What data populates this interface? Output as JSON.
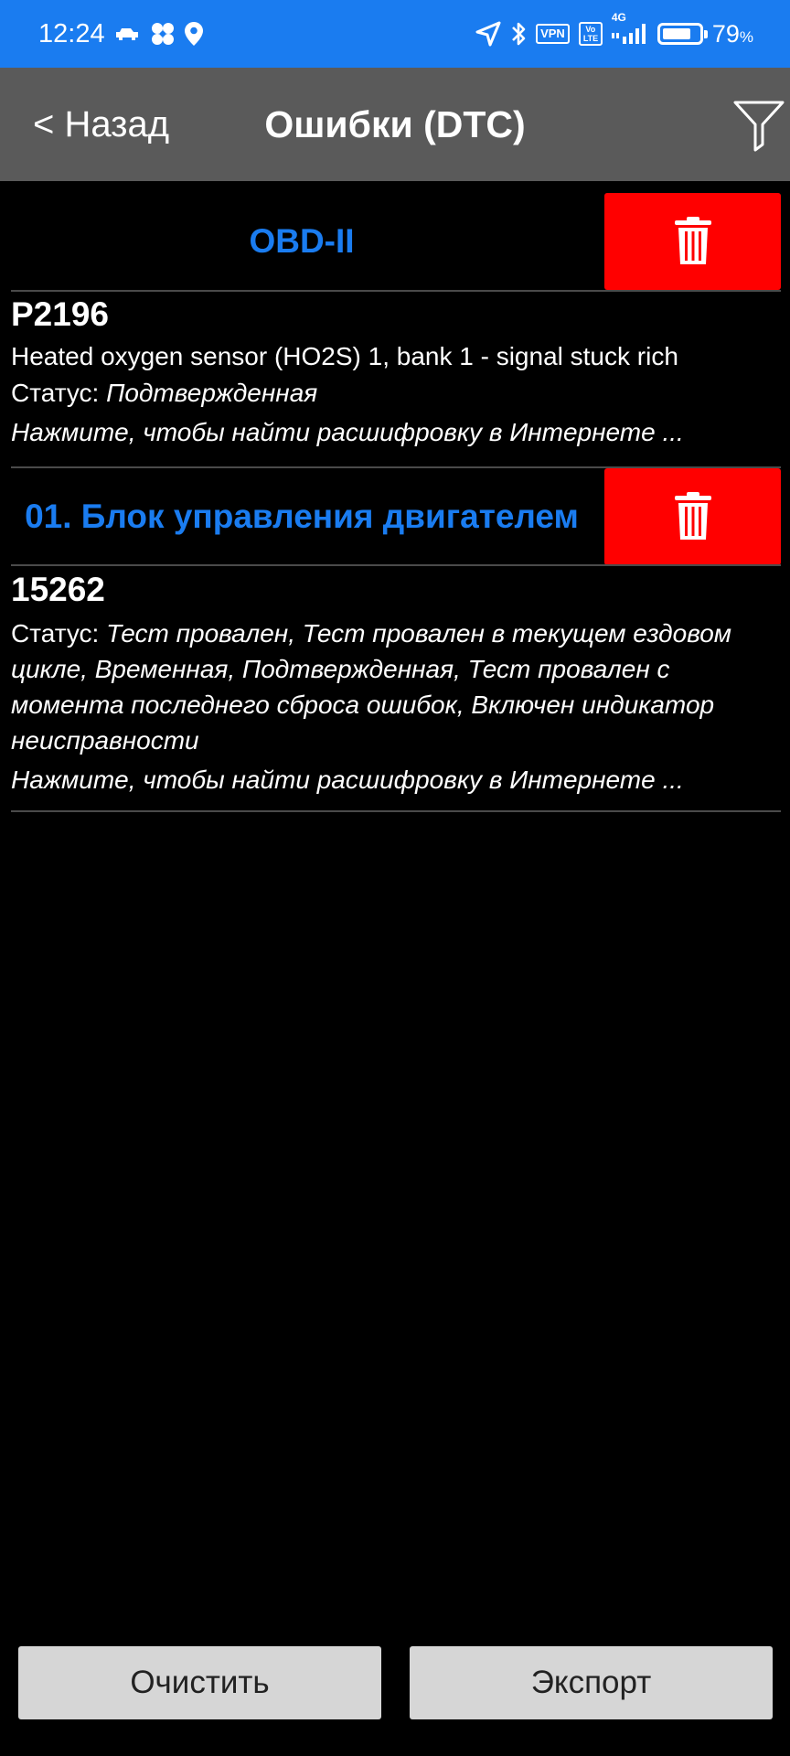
{
  "status_bar": {
    "time": "12:24",
    "vpn_label": "VPN",
    "volte_label": "Vo LTE",
    "network_label": "4G",
    "battery_level": 0.79,
    "battery_pct": "79",
    "battery_unit": "%"
  },
  "header": {
    "back_label": "< Назад",
    "title": "Ошибки (DTC)"
  },
  "groups": [
    {
      "title": "OBD-II",
      "dtcs": [
        {
          "code": "P2196",
          "description": "Heated oxygen sensor (HO2S) 1, bank 1 - signal stuck rich",
          "status_label": "Статус: ",
          "status_value": "Подтвержденная",
          "link_text": "Нажмите, чтобы найти расшифровку в Интернете ..."
        }
      ]
    },
    {
      "title": "01. Блок управления двигателем",
      "dtcs": [
        {
          "code": "15262",
          "status_label": "Статус: ",
          "status_value": "Тест провален, Тест провален в текущем ездовом цикле, Временная, Подтвержденная, Тест провален с момента последнего сброса ошибок, Включен индикатор неисправности",
          "link_text": "Нажмите, чтобы найти расшифровку в Интернете ..."
        }
      ]
    }
  ],
  "buttons": {
    "clear_label": "Очистить",
    "export_label": "Экспорт"
  },
  "colors": {
    "status_bar": "#1a7cf0",
    "header": "#5a5a5a",
    "group_title": "#1a7cf0",
    "delete_button": "#ff0000",
    "bottom_button": "#d6d6d6"
  }
}
